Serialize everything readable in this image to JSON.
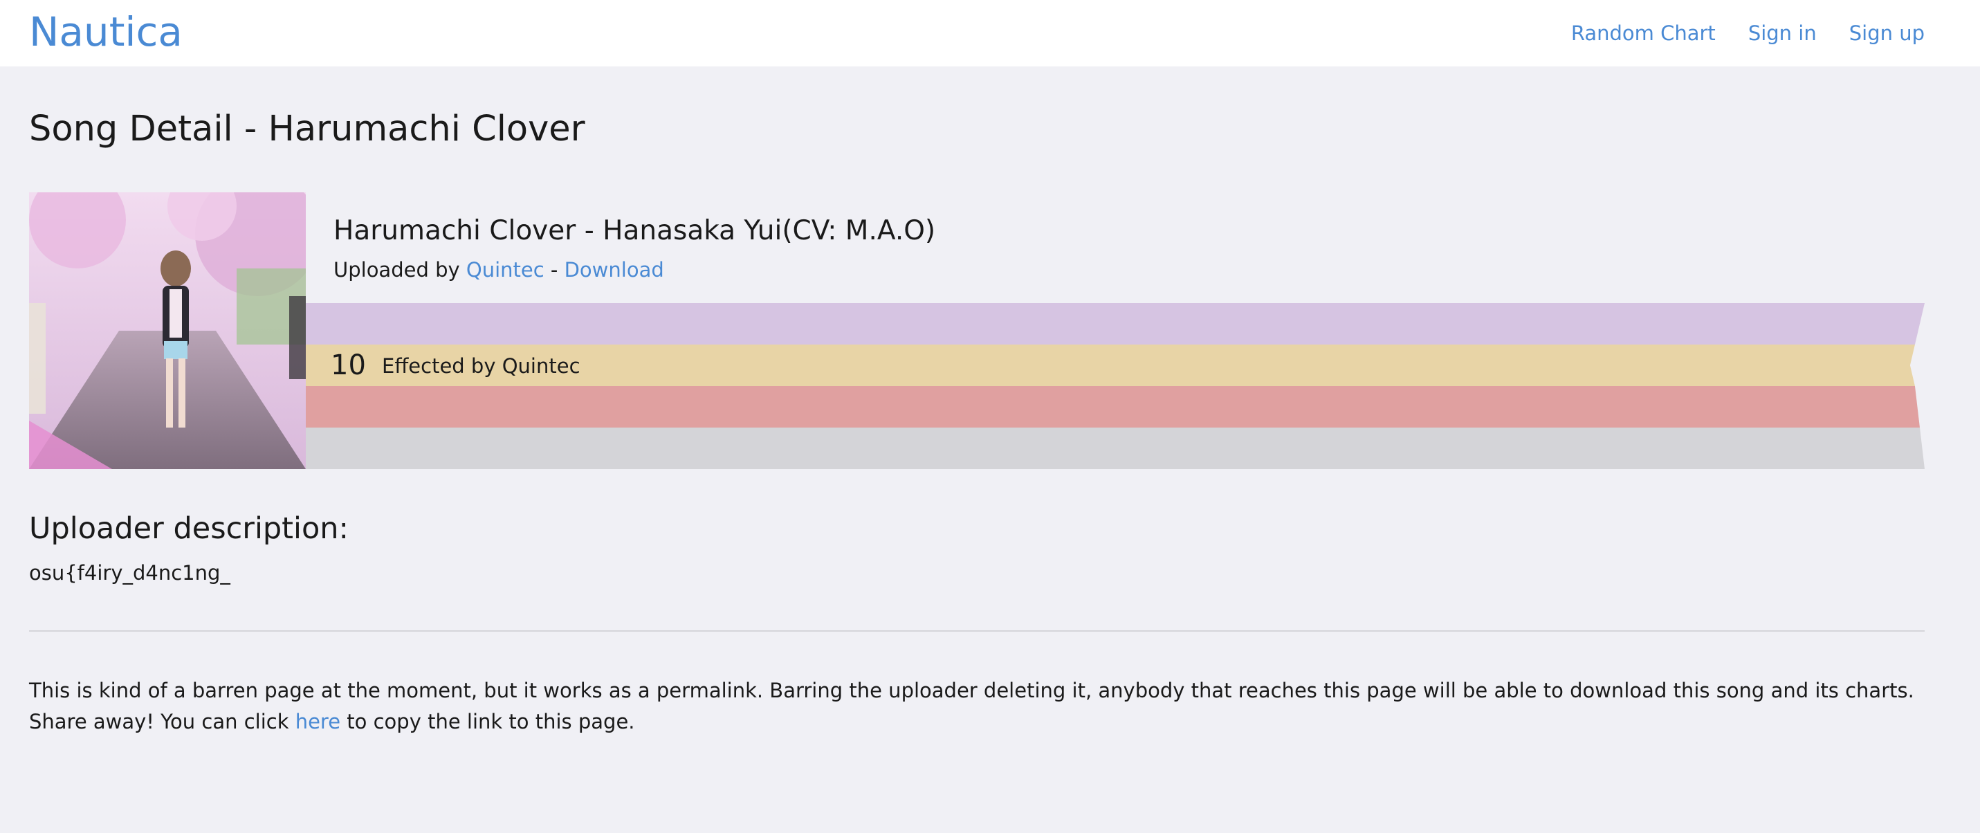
{
  "navbar": {
    "brand": "Nautica",
    "links": [
      "Random Chart",
      "Sign in",
      "Sign up"
    ]
  },
  "page_title": "Song Detail - Harumachi Clover",
  "song": {
    "title": "Harumachi Clover - Hanasaka Yui(CV: M.A.O)",
    "uploaded_by_prefix": "Uploaded by ",
    "uploader": "Quintec",
    "separator": " - ",
    "download_label": "Download",
    "chart": {
      "difficulty": "10",
      "effector": "Effected by Quintec"
    }
  },
  "description": {
    "heading": "Uploader description:",
    "text": "osu{f4iry_d4nc1ng_"
  },
  "note": {
    "text_before": "This is kind of a barren page at the moment, but it works as a permalink. Barring the uploader deleting it, anybody that reaches this page will be able to download this song and its charts. Share away! You can click ",
    "link": "here",
    "text_after": " to copy the link to this page."
  },
  "colors": {
    "link": "#4a8ad4",
    "band_novice": "#d6c4e2",
    "band_advanced": "#e8d4a6",
    "band_exhaust": "#e0a0a0",
    "band_maximum": "#d4d4d8"
  }
}
